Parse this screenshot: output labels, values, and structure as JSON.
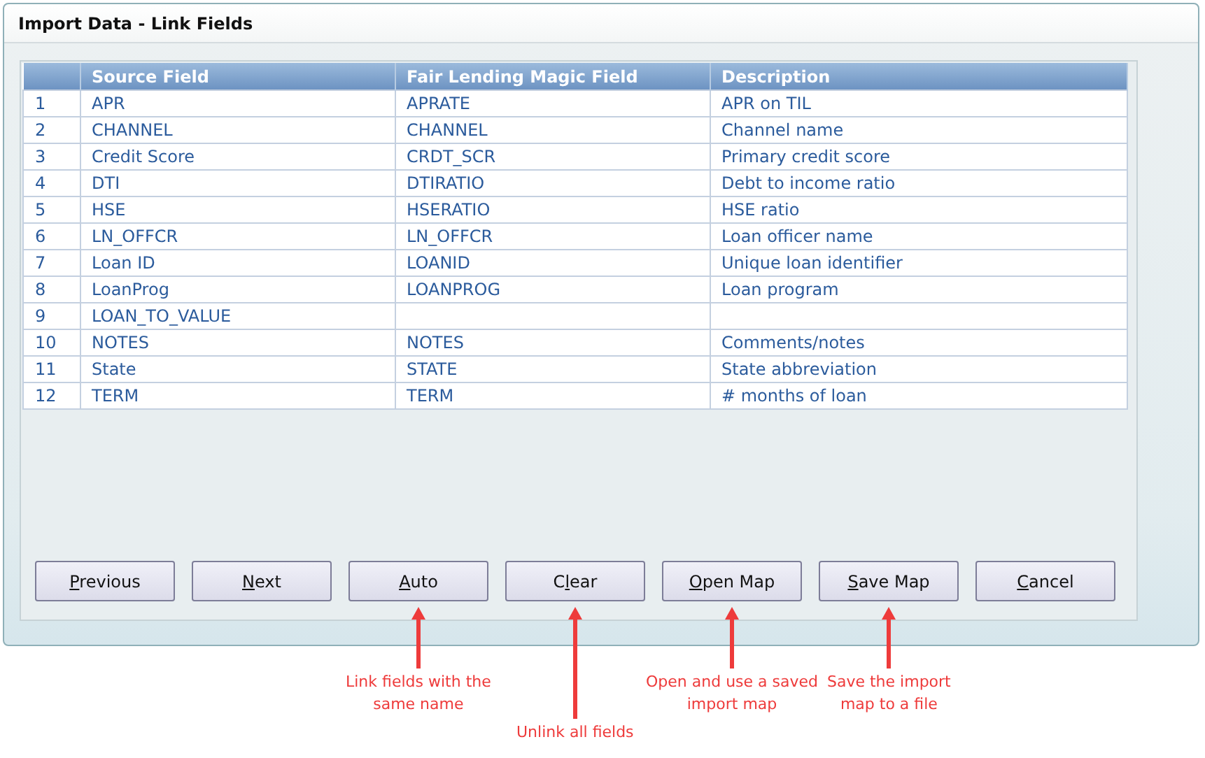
{
  "window": {
    "title": "Import Data - Link Fields"
  },
  "table": {
    "columns": [
      "Source Field",
      "Fair Lending Magic Field",
      "Description"
    ],
    "rows": [
      {
        "number": "1",
        "source": "APR",
        "target": "APRATE",
        "description": "APR on TIL"
      },
      {
        "number": "2",
        "source": "CHANNEL",
        "target": "CHANNEL",
        "description": "Channel name"
      },
      {
        "number": "3",
        "source": "Credit Score",
        "target": "CRDT_SCR",
        "description": "Primary credit score"
      },
      {
        "number": "4",
        "source": "DTI",
        "target": "DTIRATIO",
        "description": "Debt to income ratio"
      },
      {
        "number": "5",
        "source": "HSE",
        "target": "HSERATIO",
        "description": "HSE ratio"
      },
      {
        "number": "6",
        "source": "LN_OFFCR",
        "target": "LN_OFFCR",
        "description": "Loan officer name"
      },
      {
        "number": "7",
        "source": "Loan ID",
        "target": "LOANID",
        "description": "Unique loan identifier"
      },
      {
        "number": "8",
        "source": "LoanProg",
        "target": "LOANPROG",
        "description": "Loan program"
      },
      {
        "number": "9",
        "source": "LOAN_TO_VALUE"
      },
      {
        "number": "10",
        "source": "NOTES",
        "target": "NOTES",
        "description": "Comments/notes"
      },
      {
        "number": "11",
        "source": "State",
        "target": "STATE",
        "description": "State abbreviation"
      },
      {
        "number": "12",
        "source": "TERM",
        "target": "TERM",
        "description": "# months of loan"
      }
    ]
  },
  "buttons": [
    {
      "key": "P",
      "after": "revious"
    },
    {
      "key": "N",
      "after": "ext"
    },
    {
      "key": "A",
      "after": "uto",
      "annotation": {
        "lines": [
          "Link fields with the",
          "same name"
        ],
        "long_arrow": false
      }
    },
    {
      "before": "C",
      "key": "l",
      "after": "ear",
      "annotation": {
        "lines": [
          "Unlink all fields"
        ],
        "long_arrow": true
      }
    },
    {
      "key": "O",
      "after": "pen Map",
      "annotation": {
        "lines": [
          "Open and use a saved",
          "import map"
        ],
        "long_arrow": false
      }
    },
    {
      "key": "S",
      "after": "ave Map",
      "annotation": {
        "lines": [
          "Save the import",
          "map to a file"
        ],
        "long_arrow": false
      }
    },
    {
      "key": "C",
      "after": "ancel"
    }
  ]
}
